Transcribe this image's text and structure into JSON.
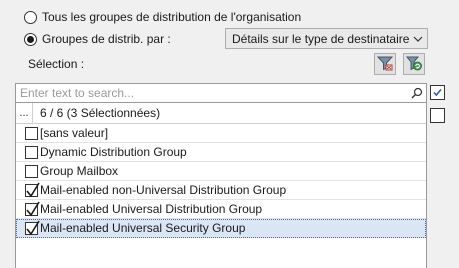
{
  "options": {
    "all_groups_label": "Tous les groupes de distribution de l'organisation",
    "by_groups_label": "Groupes de distrib. par :",
    "selected_option": "by_groups"
  },
  "filter_by": {
    "selected_value": "Détails sur le type de destinataire"
  },
  "selection": {
    "label": "Sélection :",
    "filter_icon": "filter-clear-icon",
    "refresh_icon": "filter-refresh-icon"
  },
  "search": {
    "placeholder": "Enter text to search...",
    "value": ""
  },
  "list": {
    "header_dots": "...",
    "header_label": "6 / 6 (3 Sélectionnées)",
    "items": [
      {
        "label": "[sans valeur]",
        "checked": false,
        "selected": false
      },
      {
        "label": "Dynamic Distribution Group",
        "checked": false,
        "selected": false
      },
      {
        "label": "Group Mailbox",
        "checked": false,
        "selected": false
      },
      {
        "label": "Mail-enabled non-Universal Distribution Group",
        "checked": true,
        "selected": false
      },
      {
        "label": "Mail-enabled Universal Distribution Group",
        "checked": true,
        "selected": false
      },
      {
        "label": "Mail-enabled Universal Security Group",
        "checked": true,
        "selected": true
      }
    ]
  },
  "side_checks": [
    {
      "checked": true
    },
    {
      "checked": false
    }
  ]
}
